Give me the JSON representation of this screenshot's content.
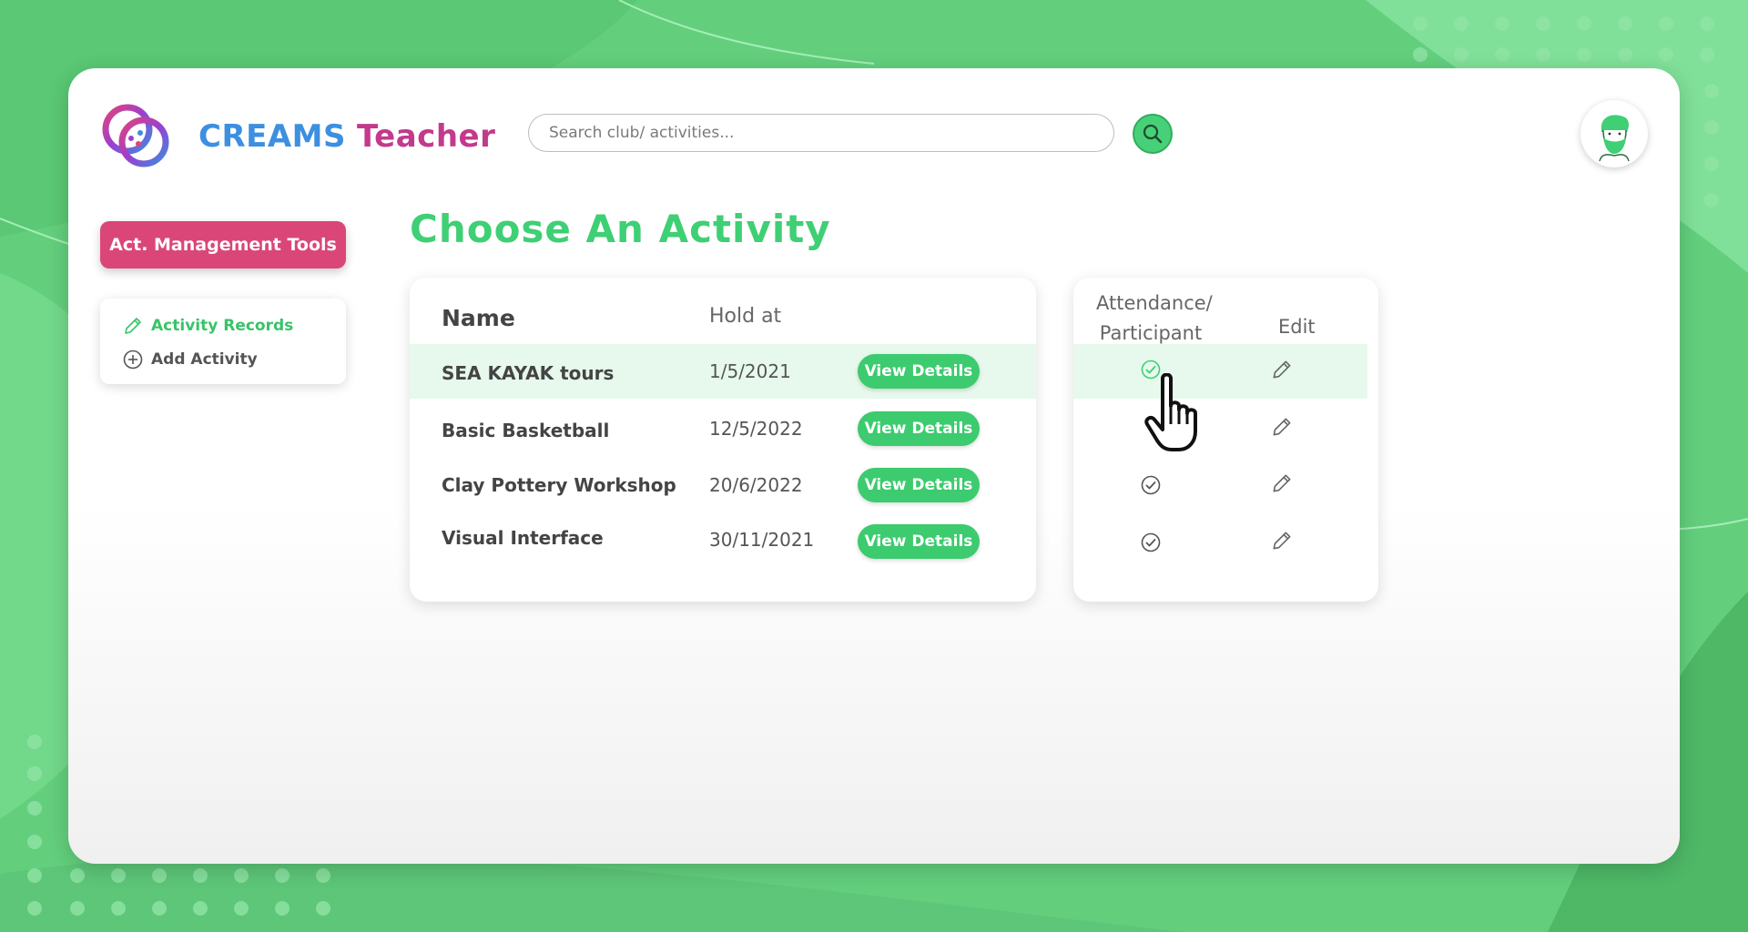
{
  "app": {
    "brand_part1": "CREAMS",
    "brand_part2": "Teacher"
  },
  "search": {
    "placeholder": "Search club/ activities...",
    "icon": "search-icon"
  },
  "user": {
    "avatar": "avatar-icon"
  },
  "sidebar": {
    "mgmt_button": "Act. Management Tools",
    "items": [
      {
        "label": "Activity Records",
        "icon": "pencil-icon",
        "active": true
      },
      {
        "label": "Add Activity",
        "icon": "plus-circle-icon",
        "active": false
      }
    ]
  },
  "main": {
    "title": "Choose An Activity",
    "table": {
      "headers": {
        "name": "Name",
        "hold_at": "Hold at"
      },
      "view_label": "View Details",
      "rows": [
        {
          "name": "SEA KAYAK tours",
          "date": "1/5/2021",
          "highlighted": true
        },
        {
          "name": "Basic Basketball",
          "date": "12/5/2022",
          "highlighted": false
        },
        {
          "name": "Clay Pottery Workshop",
          "date": "20/6/2022",
          "highlighted": false
        },
        {
          "name": "Visual Interface",
          "date": "30/11/2021",
          "highlighted": false
        }
      ]
    },
    "actions": {
      "header_attendance": "Attendance/ Participant",
      "header_edit": "Edit",
      "icons": {
        "attendance": "check-circle-icon",
        "edit": "pencil-icon"
      }
    }
  },
  "colors": {
    "accent_green": "#3fcf74",
    "brand_pink": "#db4678",
    "brand_blue": "#3d8fe0",
    "highlight_row": "#e6f9ec",
    "background": "#63cf7d"
  }
}
